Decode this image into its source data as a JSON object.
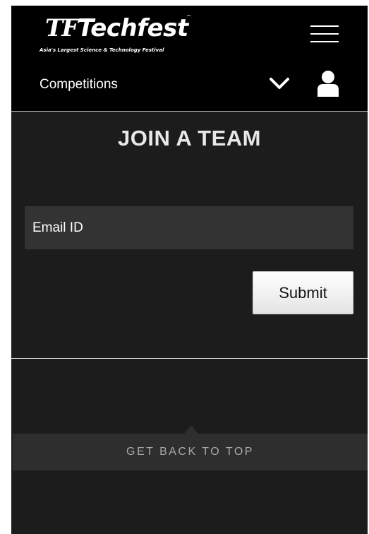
{
  "brand": {
    "logo_mark": "TF",
    "name": "Techfest",
    "trademark": "™",
    "tagline": "Asia's Largest Science & Technology Festival"
  },
  "nav": {
    "section_label": "Competitions",
    "menu_icon": "hamburger-menu-icon",
    "dropdown_icon": "chevron-down-icon",
    "user_icon": "user-profile-icon"
  },
  "main": {
    "title": "JOIN A TEAM",
    "email_placeholder": "Email ID",
    "submit_label": "Submit"
  },
  "footer": {
    "back_to_top_label": "GET BACK TO TOP"
  },
  "colors": {
    "header_bg": "#000000",
    "page_bg": "#1c1c1c",
    "field_bg": "#333333",
    "button_bg": "#f2f2f2"
  }
}
